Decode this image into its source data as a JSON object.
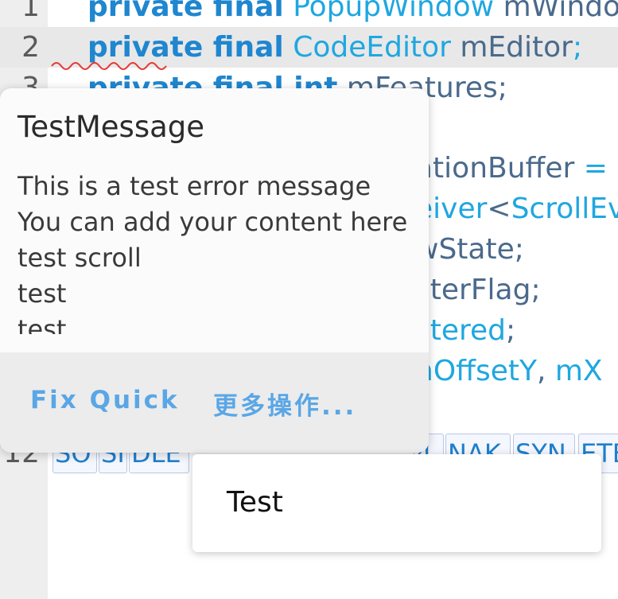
{
  "editor": {
    "line_numbers": [
      "1",
      "2",
      "3",
      "12"
    ],
    "lines": {
      "l1": {
        "kw": "private final",
        "type": "PopupWindow",
        "ident": "mWindo"
      },
      "l2": {
        "kw": "private final",
        "type": "CodeEditor",
        "ident": "mEditor",
        "punc": ";"
      },
      "l3": {
        "kw": "private final int",
        "ident": "mFeatures",
        "punc": ";"
      },
      "l5": {
        "ident": "ationBuffer",
        "punc": " ="
      },
      "l6": {
        "type1": "eiver",
        "punc": "<",
        "type2": "ScrollEv"
      },
      "l7": {
        "ident": "wState",
        "punc": ";"
      },
      "l8": {
        "ident": "sterFlag",
        "punc": ";"
      },
      "l9": {
        "type": "stered",
        "punc": ";"
      },
      "l10": {
        "type1": "nOffsetY",
        "punc": ", ",
        "type2": "mX"
      }
    },
    "control_chars": [
      "SO",
      "SI",
      "DLE",
      "4",
      "NAK",
      "SYN",
      "ETB"
    ]
  },
  "diagnostic": {
    "title": "TestMessage",
    "message_lines": [
      "This is a test error message",
      "You can add your content here",
      "test scroll",
      "test",
      "test"
    ],
    "actions": {
      "quick_fix": "Fix Quick",
      "more": "更多操作..."
    }
  },
  "completion": {
    "items": [
      "Test"
    ]
  },
  "colors": {
    "keyword": "#1f86d0",
    "type": "#1fa7e0",
    "identifier": "#4a6a8c",
    "gutter": "#eeeeee",
    "current_line": "#e8e8e8",
    "action": "#5aa6e6",
    "error_squiggle": "#e53935"
  }
}
